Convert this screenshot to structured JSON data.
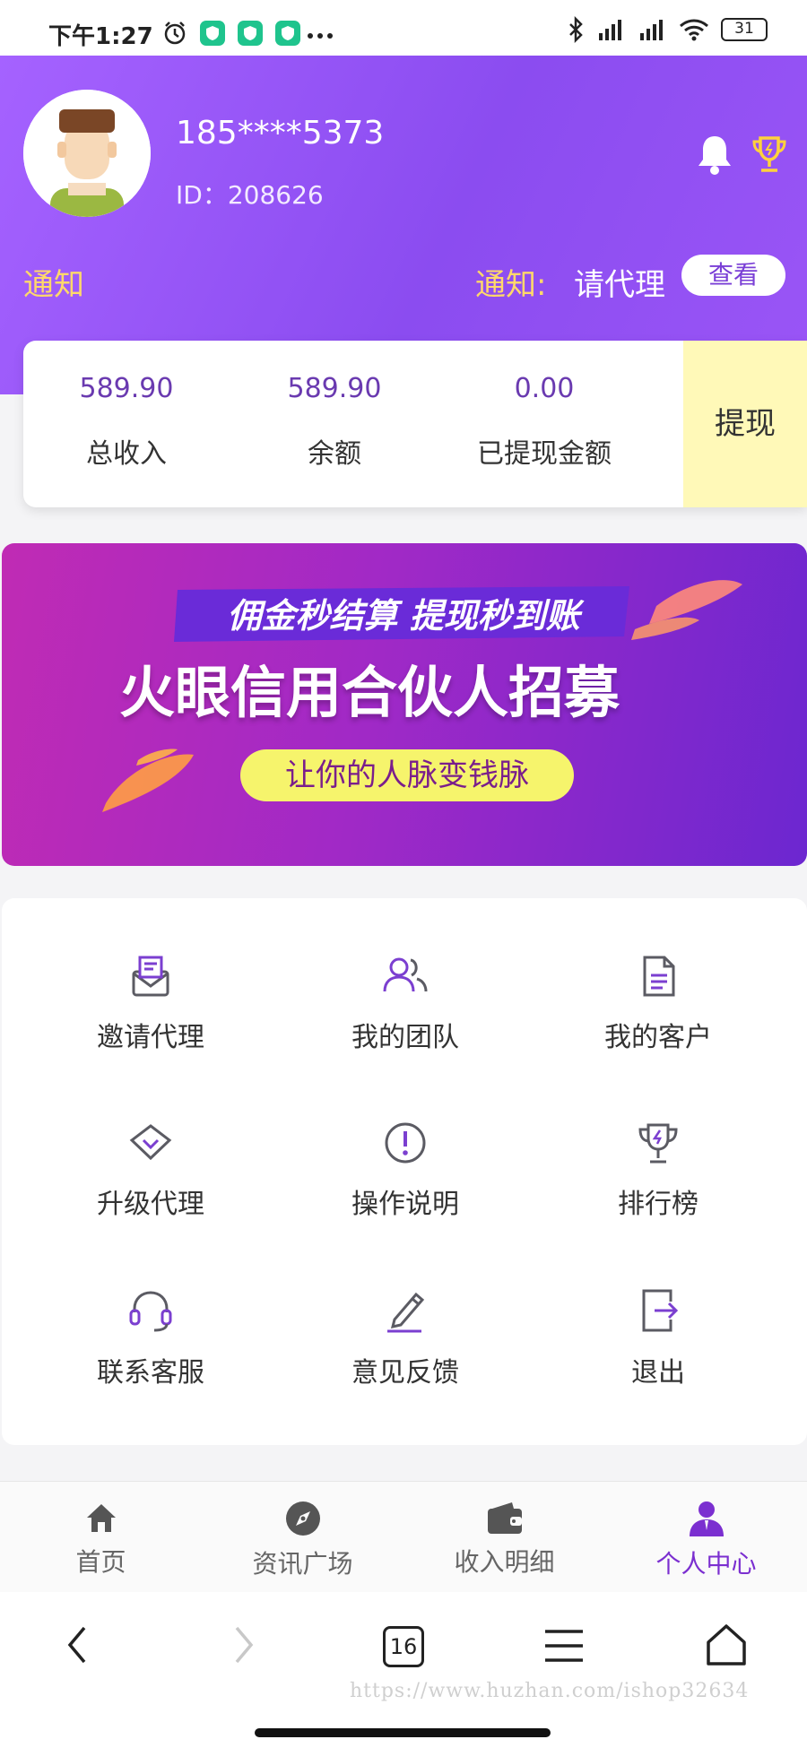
{
  "status_bar": {
    "time": "下午1:27",
    "battery": "31"
  },
  "profile": {
    "phone": "185****5373",
    "id": "ID：208626"
  },
  "notice": {
    "left_label": "通知",
    "label": "通知:",
    "text": "请代理",
    "view_button": "查看"
  },
  "stats": [
    {
      "value": "589.90",
      "label": "总收入"
    },
    {
      "value": "589.90",
      "label": "余额"
    },
    {
      "value": "0.00",
      "label": "已提现金额"
    }
  ],
  "withdraw_label": "提现",
  "banner": {
    "top_line": "佣金秒结算 提现秒到账",
    "headline": "火眼信用合伙人招募",
    "pill": "让你的人脉变钱脉"
  },
  "menu": [
    {
      "label": "邀请代理",
      "icon": "envelope-icon"
    },
    {
      "label": "我的团队",
      "icon": "team-icon"
    },
    {
      "label": "我的客户",
      "icon": "document-icon"
    },
    {
      "label": "升级代理",
      "icon": "diamond-icon"
    },
    {
      "label": "操作说明",
      "icon": "exclamation-icon"
    },
    {
      "label": "排行榜",
      "icon": "trophy-icon"
    },
    {
      "label": "联系客服",
      "icon": "headset-icon"
    },
    {
      "label": "意见反馈",
      "icon": "pencil-icon"
    },
    {
      "label": "退出",
      "icon": "logout-icon"
    }
  ],
  "bottom_nav": [
    {
      "label": "首页",
      "icon": "home-icon",
      "active": false
    },
    {
      "label": "资讯广场",
      "icon": "compass-icon",
      "active": false
    },
    {
      "label": "收入明细",
      "icon": "wallet-icon",
      "active": false
    },
    {
      "label": "个人中心",
      "icon": "person-icon",
      "active": true
    }
  ],
  "browser": {
    "tab_count": "16",
    "watermark": "https://www.huzhan.com/ishop32634"
  },
  "colors": {
    "primary": "#8b4cf0",
    "accent_yellow": "#ffd86a",
    "withdraw_bg": "#fff9b8",
    "active_nav": "#7b2fd0"
  }
}
